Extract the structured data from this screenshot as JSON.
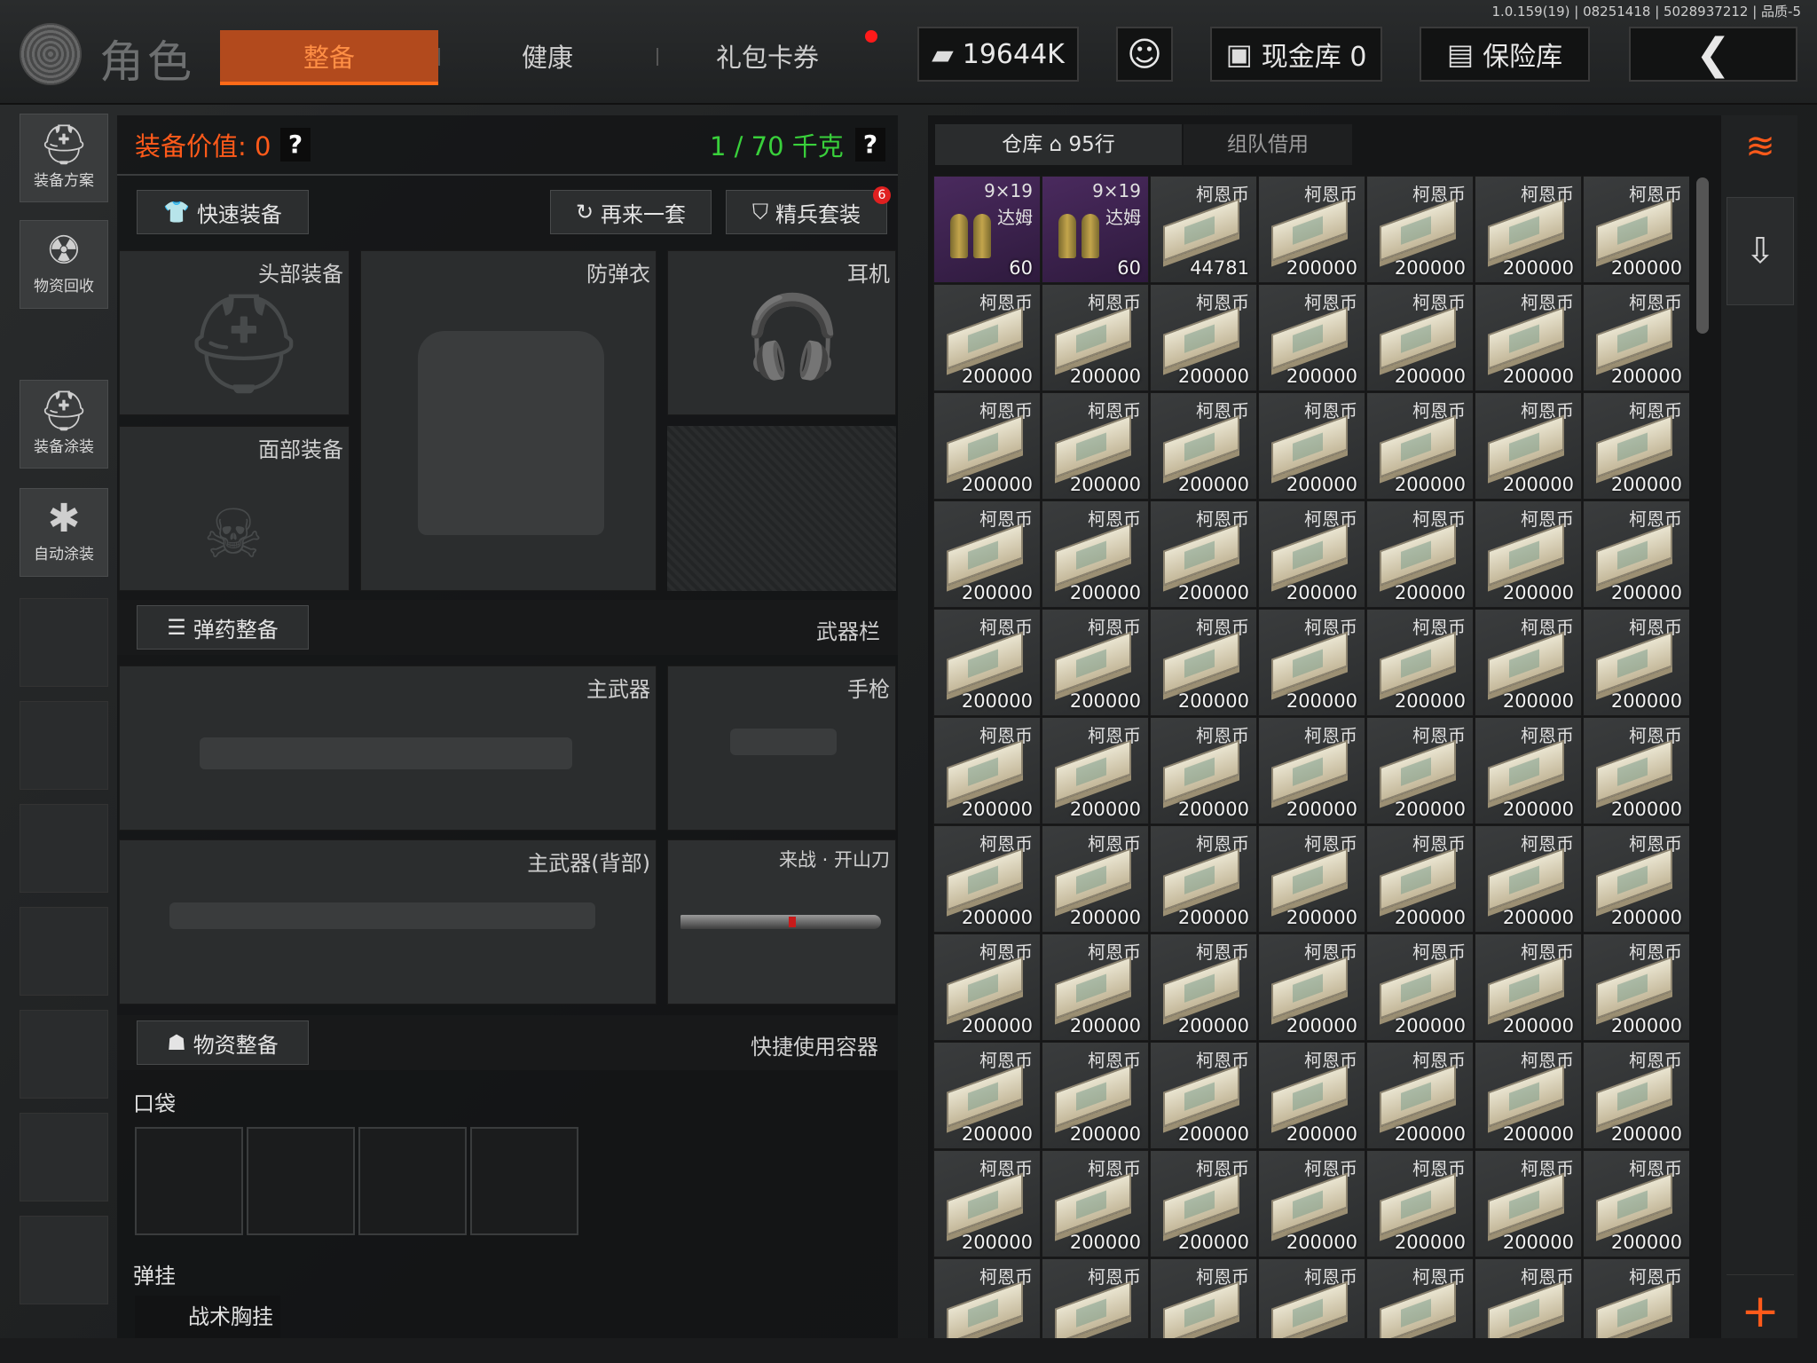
{
  "version": "1.0.159(19) | 08251418 | 5028937212 | 品质-5",
  "header": {
    "title": "角色",
    "tabs": [
      {
        "label": "整备",
        "active": true
      },
      {
        "label": "健康",
        "active": false
      },
      {
        "label": "礼包卡券",
        "active": false
      }
    ],
    "money": "19644K",
    "cash_vault": "现金库 0",
    "safe_vault": "保险库"
  },
  "sidebar": [
    {
      "label": "装备方案",
      "icon": "helmet-plan-icon"
    },
    {
      "label": "物资回收",
      "icon": "recycle-icon"
    },
    {
      "label": "装备涂装",
      "icon": "paint-helmet-icon"
    },
    {
      "label": "自动涂装",
      "icon": "brush-gear-icon"
    }
  ],
  "equipment": {
    "value_label": "装备价值: 0",
    "weight": "1 / 70 千克",
    "help": "?",
    "quick_equip": "快速装备",
    "reroll": "再来一套",
    "elite": "精兵套装",
    "elite_badge": "6",
    "slots": {
      "head": "头部装备",
      "armor": "防弹衣",
      "headset": "耳机",
      "face": "面部装备"
    },
    "ammo_section": "弹药整备",
    "weapon_bar": "武器栏",
    "weapons": {
      "primary": "主武器",
      "pistol": "手枪",
      "primary_back": "主武器(背部)",
      "melee": "来战 · 开山刀"
    },
    "supply_section": "物资整备",
    "quick_container": "快捷使用容器",
    "pocket": "口袋",
    "rig_label": "弹挂",
    "rig_item": "战术胸挂"
  },
  "warehouse": {
    "tab_label": "仓库",
    "rows": "95行",
    "team_tab": "组队借用",
    "ammo": {
      "name": "9×19",
      "sub": "达姆",
      "qty": "60"
    },
    "coin_name": "柯恩币",
    "first_coin_qty": "44781",
    "coin_qty": "200000"
  },
  "colors": {
    "accent": "#ff6a18",
    "weight_green": "#39d03b",
    "ammo_purple": "#4a2a5e"
  }
}
